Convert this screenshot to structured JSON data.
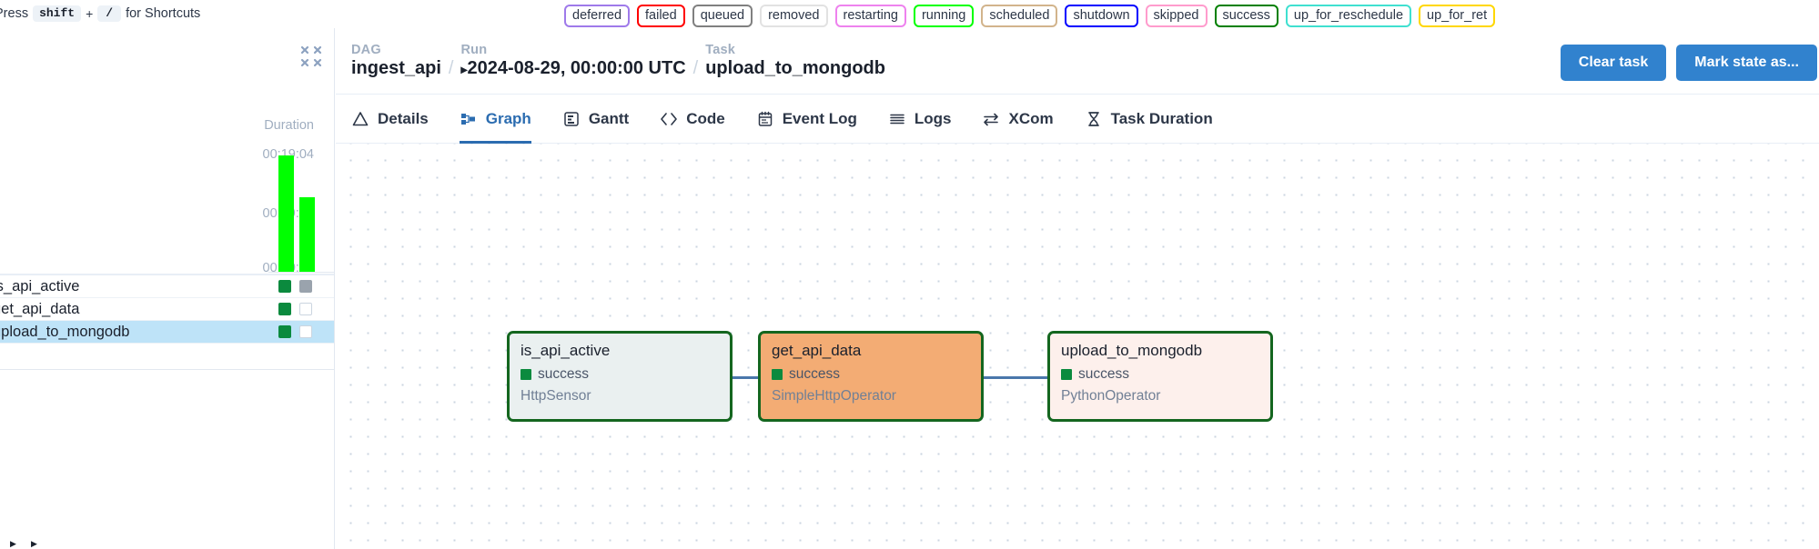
{
  "topbar": {
    "shortcut_prefix": "Press",
    "shortcut_key1": "shift",
    "shortcut_plus": "+",
    "shortcut_key2": "/",
    "shortcut_suffix": "for Shortcuts",
    "legend": [
      {
        "label": "deferred",
        "color": "#9f7aea"
      },
      {
        "label": "failed",
        "color": "#ff0000"
      },
      {
        "label": "queued",
        "color": "#808080"
      },
      {
        "label": "removed",
        "color": "#e2e2e2"
      },
      {
        "label": "restarting",
        "color": "#ee82ee"
      },
      {
        "label": "running",
        "color": "#00ff00"
      },
      {
        "label": "scheduled",
        "color": "#d2b48c"
      },
      {
        "label": "shutdown",
        "color": "#0000ff"
      },
      {
        "label": "skipped",
        "color": "#ff9ccd"
      },
      {
        "label": "success",
        "color": "#008000"
      },
      {
        "label": "up_for_reschedule",
        "color": "#40e0d0"
      },
      {
        "label": "up_for_ret",
        "color": "#ffd700"
      }
    ]
  },
  "left_panel": {
    "collapse_icon": "collapse-arrows-icon",
    "duration_title": "Duration",
    "axis_ticks": [
      "00:19:04",
      "00:09:32",
      "00:00:00"
    ],
    "bars": [
      {
        "height_pct": 91,
        "color": "#00ff00"
      },
      {
        "height_pct": 59,
        "color": "#00ff00"
      }
    ],
    "tasks": [
      {
        "name": "is_api_active",
        "selected": false,
        "squares": [
          "green",
          "gray"
        ]
      },
      {
        "name": "get_api_data",
        "selected": false,
        "squares": [
          "green",
          "hollow-gray"
        ]
      },
      {
        "name": "upload_to_mongodb",
        "selected": true,
        "squares": [
          "green",
          "hollow-white"
        ]
      }
    ]
  },
  "header": {
    "dag_kind": "DAG",
    "dag_value": "ingest_api",
    "run_kind": "Run",
    "run_caret": "▸",
    "run_value": "2024-08-29, 00:00:00 UTC",
    "task_kind": "Task",
    "task_value": "upload_to_mongodb",
    "separator": "/",
    "clear_task_label": "Clear task",
    "mark_state_label": "Mark state as...",
    "accent_color": "#3182ce"
  },
  "tabs": [
    {
      "label": "Details",
      "icon": "warning-triangle-icon",
      "active": false
    },
    {
      "label": "Graph",
      "icon": "graph-icon",
      "active": true
    },
    {
      "label": "Gantt",
      "icon": "gantt-chart-icon",
      "active": false
    },
    {
      "label": "Code",
      "icon": "code-brackets-icon",
      "active": false
    },
    {
      "label": "Event Log",
      "icon": "calendar-log-icon",
      "active": false
    },
    {
      "label": "Logs",
      "icon": "lines-list-icon",
      "active": false
    },
    {
      "label": "XCom",
      "icon": "exchange-arrows-icon",
      "active": false
    },
    {
      "label": "Task Duration",
      "icon": "hourglass-icon",
      "active": false
    }
  ],
  "graph": {
    "nodes": [
      {
        "id": "is_api_active",
        "title": "is_api_active",
        "state": "success",
        "operator": "HttpSensor",
        "bg": "#eaf0f0",
        "border": "#14661f"
      },
      {
        "id": "get_api_data",
        "title": "get_api_data",
        "state": "success",
        "operator": "SimpleHttpOperator",
        "bg": "#f3ac74",
        "border": "#14661f"
      },
      {
        "id": "upload_to_mongodb",
        "title": "upload_to_mongodb",
        "state": "success",
        "operator": "PythonOperator",
        "bg": "#fdf0ec",
        "border": "#14661f"
      }
    ],
    "edges": [
      {
        "from": "is_api_active",
        "to": "get_api_data"
      },
      {
        "from": "get_api_data",
        "to": "upload_to_mongodb"
      }
    ],
    "edge_color": "#4a77ab"
  }
}
